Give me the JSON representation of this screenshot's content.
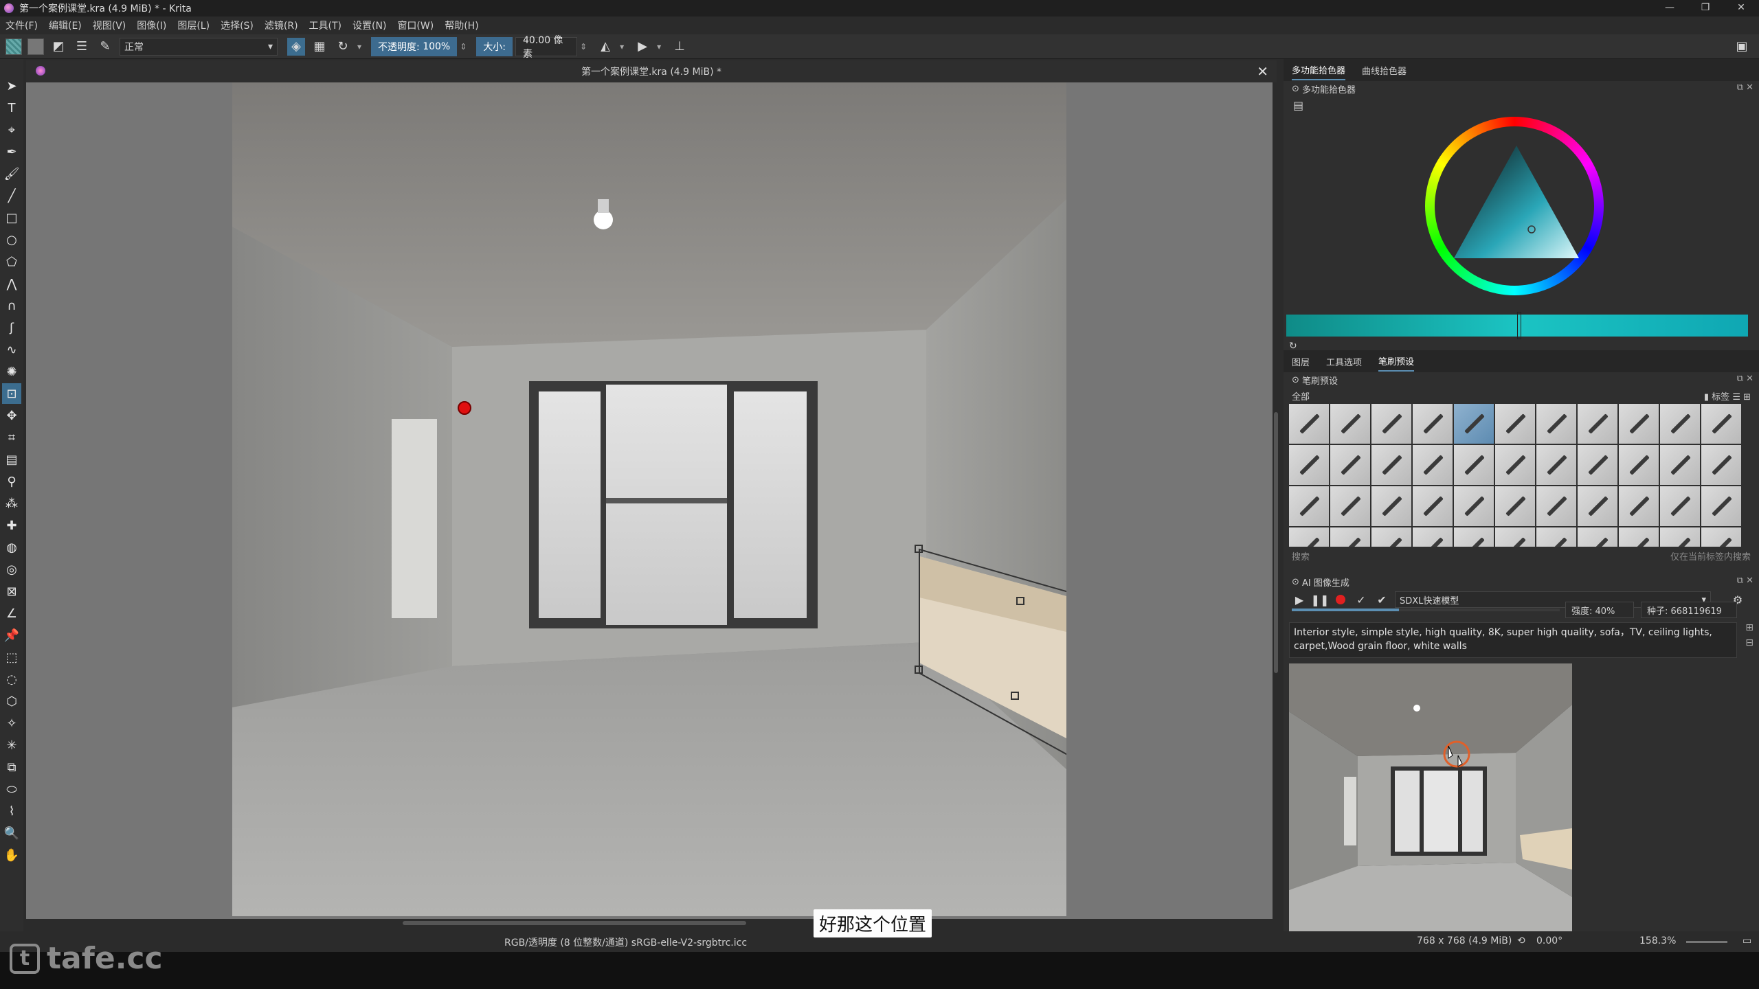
{
  "window": {
    "title": "第一个案例课堂.kra (4.9 MiB) * - Krita",
    "controls": [
      "—",
      "❐",
      "✕"
    ]
  },
  "menu": [
    "文件(F)",
    "编辑(E)",
    "视图(V)",
    "图像(I)",
    "图层(L)",
    "选择(S)",
    "滤镜(R)",
    "工具(T)",
    "设置(N)",
    "窗口(W)",
    "帮助(H)"
  ],
  "toolbar": {
    "blend_mode": "正常",
    "opacity_label": "不透明度:",
    "opacity_value": "100%",
    "size_label": "大小:",
    "size_value": "40.00 像素"
  },
  "canvas": {
    "doc_title": "第一个案例课堂.kra (4.9 MiB) *"
  },
  "docker": {
    "color_tabs": [
      "多功能拾色器",
      "曲线拾色器"
    ],
    "color_panel_title": "多功能拾色器",
    "brush_tabs": [
      "图层",
      "工具选项",
      "笔刷预设"
    ],
    "brush_panel_title": "笔刷预设",
    "brush_filter": "全部",
    "brush_tag": "标签",
    "brush_search_placeholder": "搜索",
    "brush_search_option": "仅在当前标签内搜索",
    "ai_panel_title": "AI 图像生成",
    "ai_model": "SDXL快速模型",
    "ai_strength": "强度: 40%",
    "ai_seed": "种子: 668119619",
    "ai_prompt": "Interior style, simple style, high quality, 8K, super high quality, sofa，TV, ceiling lights, carpet,Wood grain floor, white walls"
  },
  "status": {
    "color_profile": "RGB/透明度 (8 位整数/通道)  sRGB-elle-V2-srgbtrc.icc",
    "dimensions": "768 x 768 (4.9 MiB)",
    "rotation": "0.00°",
    "zoom": "158.3%"
  },
  "subtitle": "好那这个位置",
  "watermark": "tafe.cc"
}
